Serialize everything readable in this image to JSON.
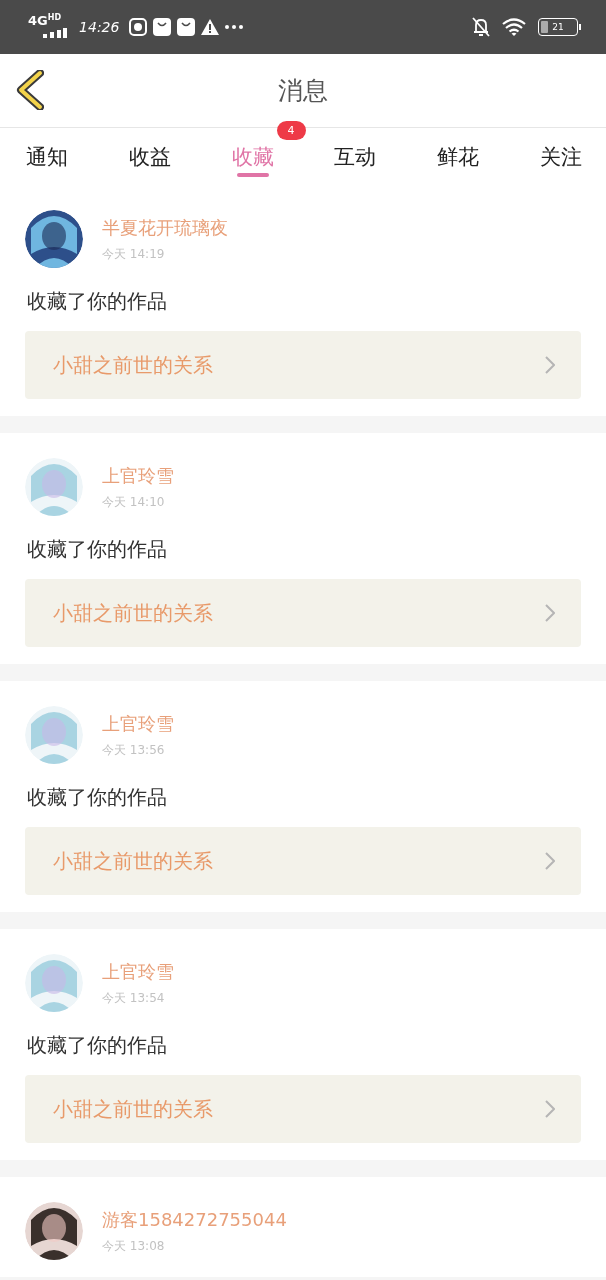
{
  "status_bar": {
    "network": "4G",
    "network_badge": "HD",
    "time": "14:26",
    "battery": "21"
  },
  "header": {
    "title": "消息"
  },
  "tabs": [
    {
      "label": "通知",
      "selected": false
    },
    {
      "label": "收益",
      "selected": false
    },
    {
      "label": "收藏",
      "selected": true,
      "badge": "4"
    },
    {
      "label": "互动",
      "selected": false
    },
    {
      "label": "鲜花",
      "selected": false
    },
    {
      "label": "关注",
      "selected": false
    }
  ],
  "messages": [
    {
      "user": "半夏花开琉璃夜",
      "time": "今天 14:19",
      "action": "收藏了你的作品",
      "work": "小甜之前世的关系"
    },
    {
      "user": "上官玲雪",
      "time": "今天 14:10",
      "action": "收藏了你的作品",
      "work": "小甜之前世的关系"
    },
    {
      "user": "上官玲雪",
      "time": "今天 13:56",
      "action": "收藏了你的作品",
      "work": "小甜之前世的关系"
    },
    {
      "user": "上官玲雪",
      "time": "今天 13:54",
      "action": "收藏了你的作品",
      "work": "小甜之前世的关系"
    },
    {
      "user": "游客1584272755044",
      "time": "今天 13:08"
    }
  ]
}
